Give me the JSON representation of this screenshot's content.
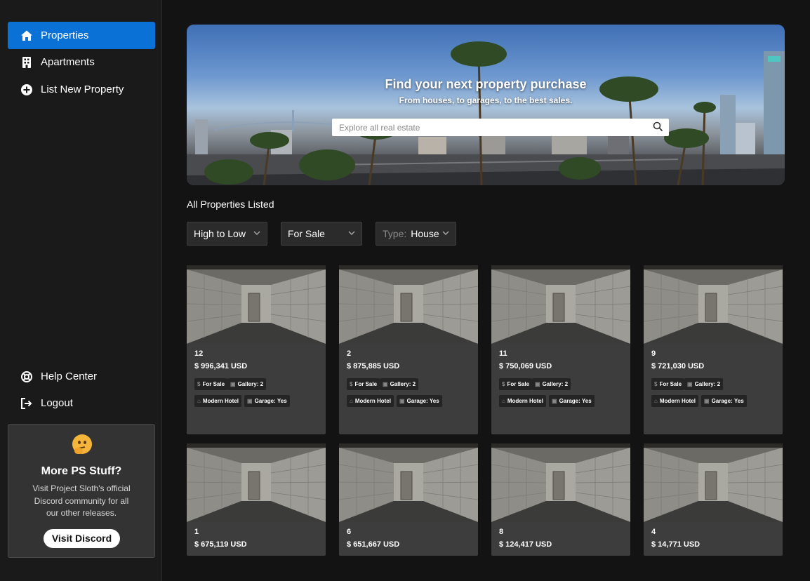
{
  "sidebar": {
    "items": [
      {
        "label": "Properties",
        "icon": "home-icon",
        "active": true
      },
      {
        "label": "Apartments",
        "icon": "building-icon",
        "active": false
      },
      {
        "label": "List New Property",
        "icon": "plus-circle-icon",
        "active": false
      }
    ],
    "bottom_items": [
      {
        "label": "Help Center",
        "icon": "lifebuoy-icon"
      },
      {
        "label": "Logout",
        "icon": "logout-icon"
      }
    ],
    "promo": {
      "emoji": "thinking-face-icon",
      "title": "More PS Stuff?",
      "text": "Visit Project Sloth's official Discord community for all our other releases.",
      "button": "Visit Discord"
    }
  },
  "hero": {
    "title": "Find your next property purchase",
    "subtitle": "From houses, to garages, to the best sales.",
    "search_placeholder": "Explore all real estate"
  },
  "section_title": "All Properties Listed",
  "filters": {
    "sort": "High to Low",
    "status": "For Sale",
    "type_prefix": "Type:",
    "type_value": "House"
  },
  "tags": {
    "status": "For Sale",
    "gallery": "Gallery: 2",
    "category": "Modern Hotel",
    "garage": "Garage: Yes"
  },
  "properties": [
    {
      "id": "12",
      "price": "$ 996,341 USD"
    },
    {
      "id": "2",
      "price": "$ 875,885 USD"
    },
    {
      "id": "11",
      "price": "$ 750,069 USD"
    },
    {
      "id": "9",
      "price": "$ 721,030 USD"
    },
    {
      "id": "1",
      "price": "$ 675,119 USD"
    },
    {
      "id": "6",
      "price": "$ 651,667 USD"
    },
    {
      "id": "8",
      "price": "$ 124,417 USD"
    },
    {
      "id": "4",
      "price": "$ 14,771 USD"
    }
  ],
  "colors": {
    "accent": "#0a72d6",
    "background": "#131313",
    "card": "#3d3d3d"
  }
}
